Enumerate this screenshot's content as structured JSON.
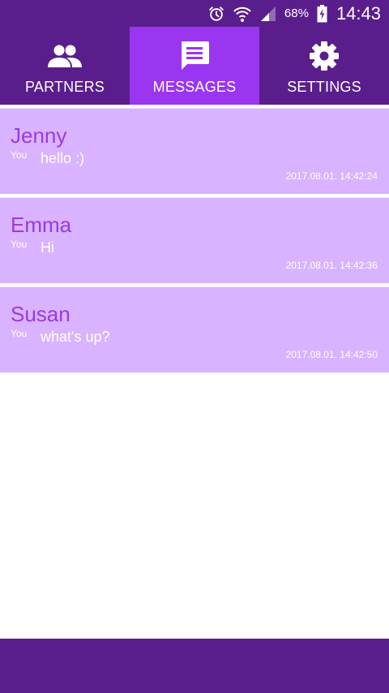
{
  "status_bar": {
    "battery_percent": "68%",
    "time": "14:43",
    "icons": [
      "alarm-icon",
      "wifi-icon",
      "signal-icon",
      "battery-charging-icon"
    ]
  },
  "tabs": [
    {
      "label": "PARTNERS",
      "icon": "people-icon",
      "active": false
    },
    {
      "label": "MESSAGES",
      "icon": "chat-icon",
      "active": true
    },
    {
      "label": "SETTINGS",
      "icon": "gear-icon",
      "active": false
    }
  ],
  "conversations": [
    {
      "name": "Jenny",
      "sender": "You",
      "message": "hello :)",
      "timestamp": "2017.08.01. 14:42:24"
    },
    {
      "name": "Emma",
      "sender": "You",
      "message": "Hi",
      "timestamp": "2017.08.01. 14:42:36"
    },
    {
      "name": "Susan",
      "sender": "You",
      "message": "what's up?",
      "timestamp": "2017.08.01. 14:42:50"
    }
  ],
  "colors": {
    "primary_dark": "#5a1e8c",
    "tab_active": "#9a35f0",
    "item_bg": "#d9b3ff",
    "name_text": "#9a3ae0"
  }
}
